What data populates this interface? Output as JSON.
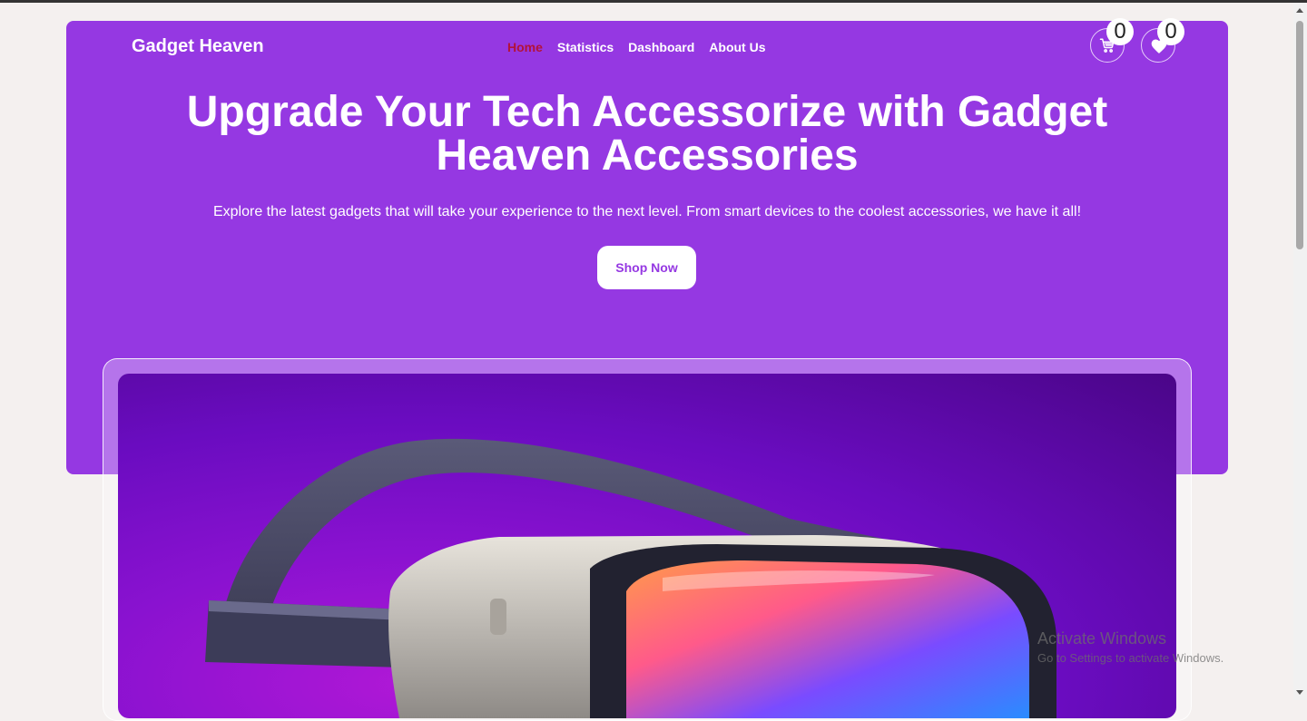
{
  "brand": "Gadget Heaven",
  "nav": {
    "items": [
      {
        "label": "Home",
        "active": true
      },
      {
        "label": "Statistics",
        "active": false
      },
      {
        "label": "Dashboard",
        "active": false
      },
      {
        "label": "About Us",
        "active": false
      }
    ]
  },
  "cart": {
    "count": "0",
    "icon": "cart-icon"
  },
  "wishlist": {
    "count": "0",
    "icon": "heart-icon"
  },
  "hero": {
    "title_line1": "Upgrade Your Tech Accessorize with Gadget",
    "title_line2": "Heaven Accessories",
    "subtitle": "Explore the latest gadgets that will take your experience to the next level. From smart devices to the coolest accessories, we have it all!",
    "cta": "Shop Now"
  },
  "banner": {
    "image": "vr-headset-image"
  },
  "watermark": {
    "title": "Activate Windows",
    "subtitle": "Go to Settings to activate Windows."
  },
  "colors": {
    "primary": "#9538e2",
    "active_nav": "#b3123a",
    "background": "#f4f0ef",
    "white": "#ffffff"
  }
}
